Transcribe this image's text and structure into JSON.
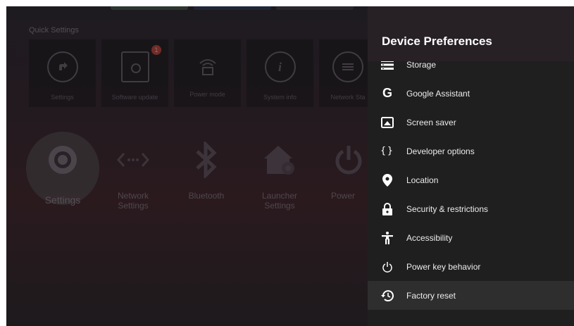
{
  "quick_settings": {
    "title": "Quick Settings",
    "tiles": [
      {
        "label": "Settings",
        "icon": "settings-arrow-icon"
      },
      {
        "label": "Software update",
        "icon": "update-icon",
        "badge": "1"
      },
      {
        "label": "Power mode",
        "icon": "power-mode-icon"
      },
      {
        "label": "System info",
        "icon": "info-icon"
      },
      {
        "label": "Network Sta",
        "icon": "network-status-icon"
      }
    ]
  },
  "apps": [
    {
      "label": "Settings",
      "icon": "gear-icon"
    },
    {
      "label": "Network\nSettings",
      "icon": "network-arrows-icon"
    },
    {
      "label": "Bluetooth",
      "icon": "bluetooth-icon"
    },
    {
      "label": "Launcher\nSettings",
      "icon": "home-gear-icon"
    },
    {
      "label": "Power",
      "icon": "power-icon"
    }
  ],
  "panel": {
    "title": "Device Preferences",
    "items": [
      {
        "label": "Storage",
        "icon": "storage-icon"
      },
      {
        "label": "Google Assistant",
        "icon": "google-icon"
      },
      {
        "label": "Screen saver",
        "icon": "screen-saver-icon"
      },
      {
        "label": "Developer options",
        "icon": "braces-icon"
      },
      {
        "label": "Location",
        "icon": "location-pin-icon"
      },
      {
        "label": "Security & restrictions",
        "icon": "lock-icon"
      },
      {
        "label": "Accessibility",
        "icon": "accessibility-icon"
      },
      {
        "label": "Power key behavior",
        "icon": "power-icon"
      },
      {
        "label": "Factory reset",
        "icon": "history-reset-icon",
        "selected": true
      }
    ]
  },
  "colors": {
    "panel_bg": "#1f1f1f",
    "panel_header_bg": "#272125",
    "selected_bg": "#2e2e2e",
    "badge": "#b53a2e"
  }
}
